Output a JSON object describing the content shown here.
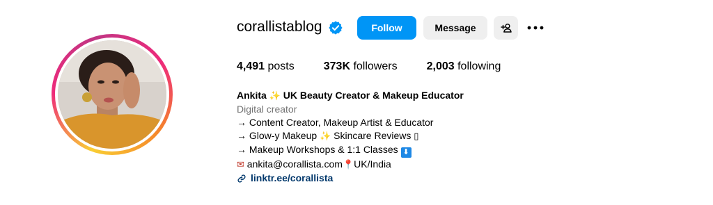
{
  "profile": {
    "username": "corallistablog",
    "verified": true,
    "avatar": "profile-photo",
    "accent": "#0095f6"
  },
  "actions": {
    "follow": "Follow",
    "message": "Message"
  },
  "stats": {
    "posts_count": "4,491",
    "posts_label": "posts",
    "followers_count": "373K",
    "followers_label": "followers",
    "following_count": "2,003",
    "following_label": "following"
  },
  "bio": {
    "name": "Ankita",
    "name_emoji": "✨",
    "headline": "UK Beauty Creator & Makeup Educator",
    "category": "Digital creator",
    "line1": "→ Content Creator, Makeup Artist & Educator",
    "line2_a": "→ Glow-y Makeup ",
    "line2_emoji": "✨",
    "line2_b": " Skincare Reviews ",
    "line2_tail": "▯",
    "line3": "→ Makeup Workshops & 1:1 Classes ",
    "line3_emoji": "⬇",
    "email_emoji": "✉",
    "email": "ankita@corallista.com",
    "pin_emoji": "📍",
    "location": "UK/India",
    "link": "linktr.ee/corallista"
  }
}
